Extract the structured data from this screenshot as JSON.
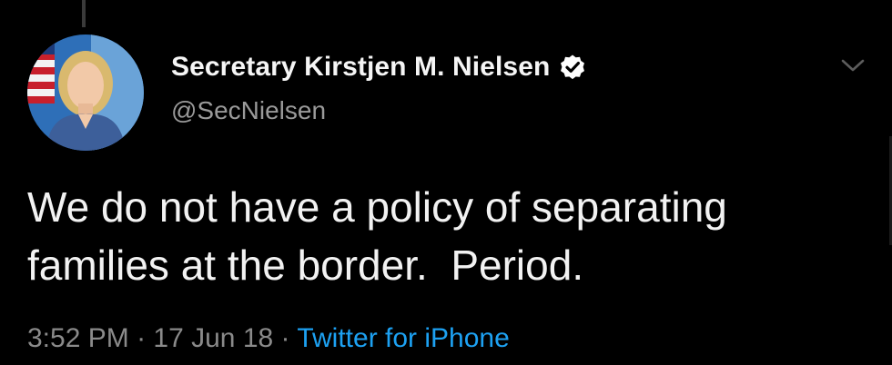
{
  "tweet": {
    "author": {
      "display_name": "Secretary Kirstjen M. Nielsen",
      "handle": "@SecNielsen",
      "verified_icon": "verified-badge-icon",
      "avatar_icon": "profile-photo"
    },
    "menu_icon": "chevron-down-icon",
    "text": "We do not have a policy of separating families at the border.  Period.",
    "time": "3:52 PM",
    "separator": "·",
    "date": "17 Jun 18",
    "source": "Twitter for iPhone"
  },
  "colors": {
    "background": "#000000",
    "name": "#f5f5f5",
    "secondary_text": "#9a9a9a",
    "link": "#1da1f2"
  }
}
